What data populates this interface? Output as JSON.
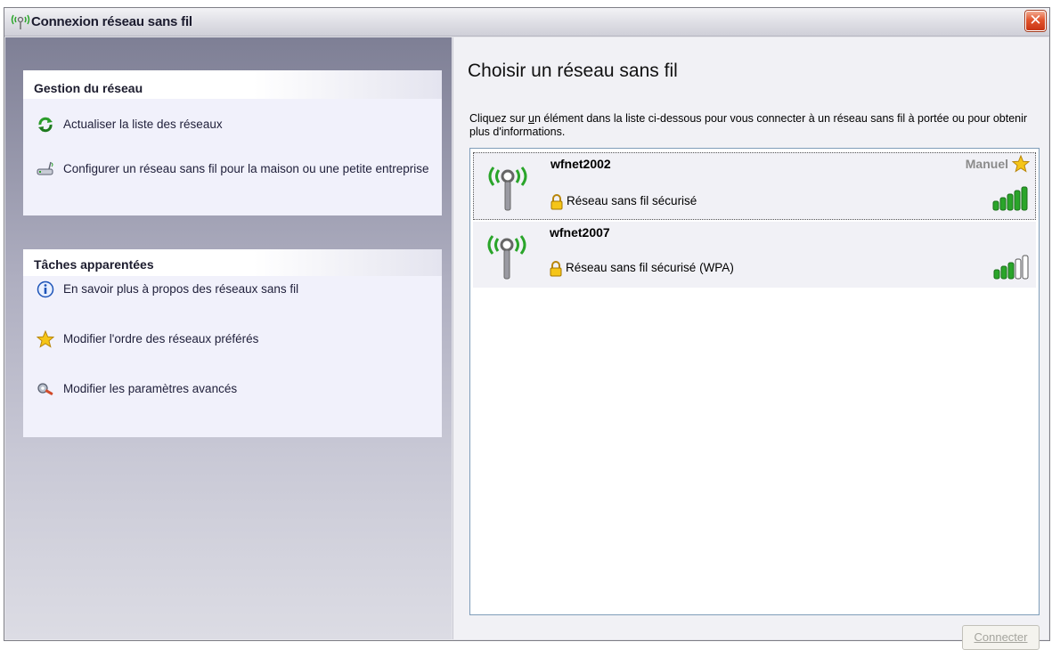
{
  "window": {
    "title": "Connexion réseau sans fil",
    "close_symbol": "✕"
  },
  "left_pane": {
    "network_management": {
      "header": "Gestion du réseau",
      "tasks": [
        {
          "label": "Actualiser la liste des réseaux",
          "icon": "refresh-icon"
        },
        {
          "label": "Configurer un réseau sans fil pour la maison ou une petite entreprise",
          "icon": "wireless-router-icon"
        }
      ]
    },
    "related_tasks": {
      "header": "Tâches apparentées",
      "tasks": [
        {
          "label": "En savoir plus à propos des réseaux sans fil",
          "icon": "info-icon"
        },
        {
          "label": "Modifier l'ordre des réseaux préférés",
          "icon": "star-icon"
        },
        {
          "label": "Modifier les paramètres avancés",
          "icon": "settings-icon"
        }
      ]
    }
  },
  "right_pane": {
    "title": "Choisir un réseau sans fil",
    "description_before": "Cliquez sur ",
    "description_underlined": "u",
    "description_after": "n élément dans la liste ci-dessous pour vous connecter à un réseau sans fil à portée ou pour obtenir plus d'informations.",
    "networks": [
      {
        "name": "wfnet2002",
        "security": "Réseau sans fil sécurisé",
        "status": "Manuel",
        "preferred": true,
        "signal_bars": 5,
        "selected": true
      },
      {
        "name": "wfnet2007",
        "security": "Réseau sans fil sécurisé (WPA)",
        "status": "",
        "preferred": false,
        "signal_bars": 3,
        "selected": false
      }
    ],
    "connect_button": "Connecter"
  },
  "colors": {
    "signal_green": "#2aa52a",
    "link_blue": "#1f1f3a",
    "title_close_red": "#e2552d"
  }
}
